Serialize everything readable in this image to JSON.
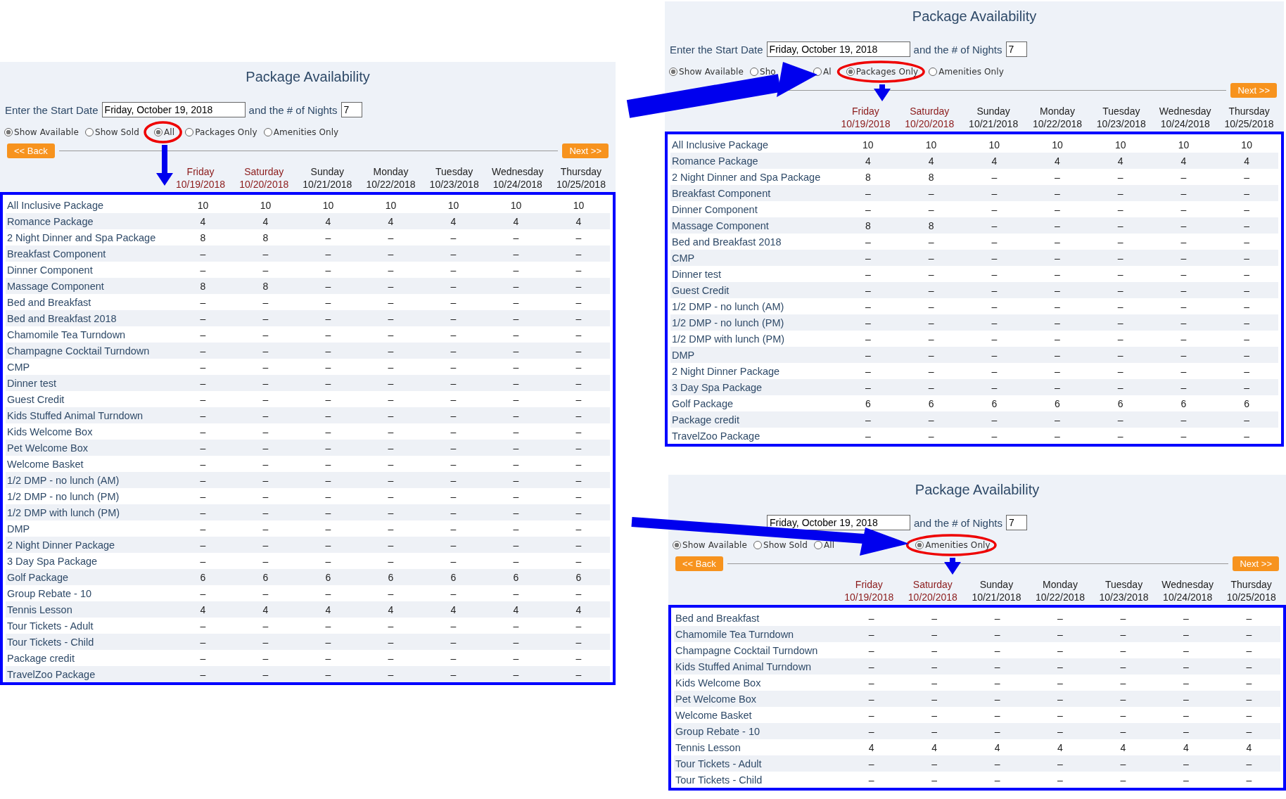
{
  "panels": [
    {
      "title": "Package Availability",
      "start_label": "Enter the Start Date",
      "date_value": "Friday, October 19, 2018",
      "nights_label": "and the # of Nights",
      "nights_value": "7",
      "show_options": [
        {
          "kind": "radio",
          "label": "Show Available",
          "selected": true
        },
        {
          "kind": "radio",
          "label": "Show Sold",
          "selected": false
        }
      ],
      "filters": [
        {
          "kind": "radio",
          "label": "All",
          "selected": true,
          "circled": true
        },
        {
          "kind": "radio",
          "label": "Packages Only",
          "selected": false,
          "circled": false
        },
        {
          "kind": "radio",
          "label": "Amenities Only",
          "selected": false,
          "circled": false
        }
      ],
      "back": "<< Back",
      "next": "Next >>",
      "days": [
        {
          "day": "Friday",
          "date": "10/19/2018",
          "weekend": true
        },
        {
          "day": "Saturday",
          "date": "10/20/2018",
          "weekend": true
        },
        {
          "day": "Sunday",
          "date": "10/21/2018",
          "weekend": false
        },
        {
          "day": "Monday",
          "date": "10/22/2018",
          "weekend": false
        },
        {
          "day": "Tuesday",
          "date": "10/23/2018",
          "weekend": false
        },
        {
          "day": "Wednesday",
          "date": "10/24/2018",
          "weekend": false
        },
        {
          "day": "Thursday",
          "date": "10/25/2018",
          "weekend": false
        }
      ],
      "rows": [
        {
          "name": "All Inclusive Package",
          "values": [
            "10",
            "10",
            "10",
            "10",
            "10",
            "10",
            "10"
          ]
        },
        {
          "name": "Romance Package",
          "values": [
            "4",
            "4",
            "4",
            "4",
            "4",
            "4",
            "4"
          ]
        },
        {
          "name": "2 Night Dinner and Spa Package",
          "values": [
            "8",
            "8",
            "–",
            "–",
            "–",
            "–",
            "–"
          ]
        },
        {
          "name": "Breakfast Component",
          "values": [
            "–",
            "–",
            "–",
            "–",
            "–",
            "–",
            "–"
          ]
        },
        {
          "name": "Dinner Component",
          "values": [
            "–",
            "–",
            "–",
            "–",
            "–",
            "–",
            "–"
          ]
        },
        {
          "name": "Massage Component",
          "values": [
            "8",
            "8",
            "–",
            "–",
            "–",
            "–",
            "–"
          ]
        },
        {
          "name": "Bed and Breakfast",
          "values": [
            "–",
            "–",
            "–",
            "–",
            "–",
            "–",
            "–"
          ]
        },
        {
          "name": "Bed and Breakfast 2018",
          "values": [
            "–",
            "–",
            "–",
            "–",
            "–",
            "–",
            "–"
          ]
        },
        {
          "name": "Chamomile Tea Turndown",
          "values": [
            "–",
            "–",
            "–",
            "–",
            "–",
            "–",
            "–"
          ]
        },
        {
          "name": "Champagne Cocktail Turndown",
          "values": [
            "–",
            "–",
            "–",
            "–",
            "–",
            "–",
            "–"
          ]
        },
        {
          "name": "CMP",
          "values": [
            "–",
            "–",
            "–",
            "–",
            "–",
            "–",
            "–"
          ]
        },
        {
          "name": "Dinner test",
          "values": [
            "–",
            "–",
            "–",
            "–",
            "–",
            "–",
            "–"
          ]
        },
        {
          "name": "Guest Credit",
          "values": [
            "–",
            "–",
            "–",
            "–",
            "–",
            "–",
            "–"
          ]
        },
        {
          "name": "Kids Stuffed Animal Turndown",
          "values": [
            "–",
            "–",
            "–",
            "–",
            "–",
            "–",
            "–"
          ]
        },
        {
          "name": "Kids Welcome Box",
          "values": [
            "–",
            "–",
            "–",
            "–",
            "–",
            "–",
            "–"
          ]
        },
        {
          "name": "Pet Welcome Box",
          "values": [
            "–",
            "–",
            "–",
            "–",
            "–",
            "–",
            "–"
          ]
        },
        {
          "name": "Welcome Basket",
          "values": [
            "–",
            "–",
            "–",
            "–",
            "–",
            "–",
            "–"
          ]
        },
        {
          "name": "1/2 DMP - no lunch (AM)",
          "values": [
            "–",
            "–",
            "–",
            "–",
            "–",
            "–",
            "–"
          ]
        },
        {
          "name": "1/2 DMP - no lunch (PM)",
          "values": [
            "–",
            "–",
            "–",
            "–",
            "–",
            "–",
            "–"
          ]
        },
        {
          "name": "1/2 DMP with lunch (PM)",
          "values": [
            "–",
            "–",
            "–",
            "–",
            "–",
            "–",
            "–"
          ]
        },
        {
          "name": "DMP",
          "values": [
            "–",
            "–",
            "–",
            "–",
            "–",
            "–",
            "–"
          ]
        },
        {
          "name": "2 Night Dinner Package",
          "values": [
            "–",
            "–",
            "–",
            "–",
            "–",
            "–",
            "–"
          ]
        },
        {
          "name": "3 Day Spa Package",
          "values": [
            "–",
            "–",
            "–",
            "–",
            "–",
            "–",
            "–"
          ]
        },
        {
          "name": "Golf Package",
          "values": [
            "6",
            "6",
            "6",
            "6",
            "6",
            "6",
            "6"
          ]
        },
        {
          "name": "Group Rebate - 10",
          "values": [
            "–",
            "–",
            "–",
            "–",
            "–",
            "–",
            "–"
          ]
        },
        {
          "name": "Tennis Lesson",
          "values": [
            "4",
            "4",
            "4",
            "4",
            "4",
            "4",
            "4"
          ]
        },
        {
          "name": "Tour Tickets - Adult",
          "values": [
            "–",
            "–",
            "–",
            "–",
            "–",
            "–",
            "–"
          ]
        },
        {
          "name": "Tour Tickets - Child",
          "values": [
            "–",
            "–",
            "–",
            "–",
            "–",
            "–",
            "–"
          ]
        },
        {
          "name": "Package credit",
          "values": [
            "–",
            "–",
            "–",
            "–",
            "–",
            "–",
            "–"
          ]
        },
        {
          "name": "TravelZoo Package",
          "values": [
            "–",
            "–",
            "–",
            "–",
            "–",
            "–",
            "–"
          ]
        }
      ]
    },
    {
      "title": "Package Availability",
      "start_label": "Enter the Start Date",
      "date_value": "Friday, October 19, 2018",
      "nights_label": "and the # of Nights",
      "nights_value": "7",
      "show_options": [
        {
          "kind": "radio",
          "label": "Show Available",
          "selected": true
        },
        {
          "kind": "cut",
          "label": "Sho",
          "selected": false
        }
      ],
      "filters": [
        {
          "kind": "radio",
          "label": "Al",
          "selected": false,
          "circled": false
        },
        {
          "kind": "radio",
          "label": "Packages Only",
          "selected": true,
          "circled": true
        },
        {
          "kind": "radio",
          "label": "Amenities Only",
          "selected": false,
          "circled": false
        }
      ],
      "next": "Next >>",
      "days": [
        {
          "day": "Friday",
          "date": "10/19/2018",
          "weekend": true
        },
        {
          "day": "Saturday",
          "date": "10/20/2018",
          "weekend": true
        },
        {
          "day": "Sunday",
          "date": "10/21/2018",
          "weekend": false
        },
        {
          "day": "Monday",
          "date": "10/22/2018",
          "weekend": false
        },
        {
          "day": "Tuesday",
          "date": "10/23/2018",
          "weekend": false
        },
        {
          "day": "Wednesday",
          "date": "10/24/2018",
          "weekend": false
        },
        {
          "day": "Thursday",
          "date": "10/25/2018",
          "weekend": false
        }
      ],
      "rows": [
        {
          "name": "All Inclusive Package",
          "values": [
            "10",
            "10",
            "10",
            "10",
            "10",
            "10",
            "10"
          ]
        },
        {
          "name": "Romance Package",
          "values": [
            "4",
            "4",
            "4",
            "4",
            "4",
            "4",
            "4"
          ]
        },
        {
          "name": "2 Night Dinner and Spa Package",
          "values": [
            "8",
            "8",
            "–",
            "–",
            "–",
            "–",
            "–"
          ]
        },
        {
          "name": "Breakfast Component",
          "values": [
            "–",
            "–",
            "–",
            "–",
            "–",
            "–",
            "–"
          ]
        },
        {
          "name": "Dinner Component",
          "values": [
            "–",
            "–",
            "–",
            "–",
            "–",
            "–",
            "–"
          ]
        },
        {
          "name": "Massage Component",
          "values": [
            "8",
            "8",
            "–",
            "–",
            "–",
            "–",
            "–"
          ]
        },
        {
          "name": "Bed and Breakfast 2018",
          "values": [
            "–",
            "–",
            "–",
            "–",
            "–",
            "–",
            "–"
          ]
        },
        {
          "name": "CMP",
          "values": [
            "–",
            "–",
            "–",
            "–",
            "–",
            "–",
            "–"
          ]
        },
        {
          "name": "Dinner test",
          "values": [
            "–",
            "–",
            "–",
            "–",
            "–",
            "–",
            "–"
          ]
        },
        {
          "name": "Guest Credit",
          "values": [
            "–",
            "–",
            "–",
            "–",
            "–",
            "–",
            "–"
          ]
        },
        {
          "name": "1/2 DMP - no lunch (AM)",
          "values": [
            "–",
            "–",
            "–",
            "–",
            "–",
            "–",
            "–"
          ]
        },
        {
          "name": "1/2 DMP - no lunch (PM)",
          "values": [
            "–",
            "–",
            "–",
            "–",
            "–",
            "–",
            "–"
          ]
        },
        {
          "name": "1/2 DMP with lunch (PM)",
          "values": [
            "–",
            "–",
            "–",
            "–",
            "–",
            "–",
            "–"
          ]
        },
        {
          "name": "DMP",
          "values": [
            "–",
            "–",
            "–",
            "–",
            "–",
            "–",
            "–"
          ]
        },
        {
          "name": "2 Night Dinner Package",
          "values": [
            "–",
            "–",
            "–",
            "–",
            "–",
            "–",
            "–"
          ]
        },
        {
          "name": "3 Day Spa Package",
          "values": [
            "–",
            "–",
            "–",
            "–",
            "–",
            "–",
            "–"
          ]
        },
        {
          "name": "Golf Package",
          "values": [
            "6",
            "6",
            "6",
            "6",
            "6",
            "6",
            "6"
          ]
        },
        {
          "name": "Package credit",
          "values": [
            "–",
            "–",
            "–",
            "–",
            "–",
            "–",
            "–"
          ]
        },
        {
          "name": "TravelZoo Package",
          "values": [
            "–",
            "–",
            "–",
            "–",
            "–",
            "–",
            "–"
          ]
        }
      ]
    },
    {
      "title": "Package Availability",
      "date_value": "Friday, October 19, 2018",
      "nights_label": "and the # of Nights",
      "nights_value": "7",
      "show_options": [
        {
          "kind": "radio",
          "label": "Show Available",
          "selected": true
        },
        {
          "kind": "radio",
          "label": "Show Sold",
          "selected": false
        }
      ],
      "filters": [
        {
          "kind": "radio",
          "label": "All",
          "selected": false,
          "circled": false
        },
        {
          "kind": "covered"
        },
        {
          "kind": "radio",
          "label": "Amenities Only",
          "selected": true,
          "circled": true
        }
      ],
      "back": "<< Back",
      "next": "Next >>",
      "days": [
        {
          "day": "Friday",
          "date": "10/19/2018",
          "weekend": true
        },
        {
          "day": "Saturday",
          "date": "10/20/2018",
          "weekend": true
        },
        {
          "day": "Sunday",
          "date": "10/21/2018",
          "weekend": false
        },
        {
          "day": "Monday",
          "date": "10/22/2018",
          "weekend": false
        },
        {
          "day": "Tuesday",
          "date": "10/23/2018",
          "weekend": false
        },
        {
          "day": "Wednesday",
          "date": "10/24/2018",
          "weekend": false
        },
        {
          "day": "Thursday",
          "date": "10/25/2018",
          "weekend": false
        }
      ],
      "rows": [
        {
          "name": "Bed and Breakfast",
          "values": [
            "–",
            "–",
            "–",
            "–",
            "–",
            "–",
            "–"
          ]
        },
        {
          "name": "Chamomile Tea Turndown",
          "values": [
            "–",
            "–",
            "–",
            "–",
            "–",
            "–",
            "–"
          ]
        },
        {
          "name": "Champagne Cocktail Turndown",
          "values": [
            "–",
            "–",
            "–",
            "–",
            "–",
            "–",
            "–"
          ]
        },
        {
          "name": "Kids Stuffed Animal Turndown",
          "values": [
            "–",
            "–",
            "–",
            "–",
            "–",
            "–",
            "–"
          ]
        },
        {
          "name": "Kids Welcome Box",
          "values": [
            "–",
            "–",
            "–",
            "–",
            "–",
            "–",
            "–"
          ]
        },
        {
          "name": "Pet Welcome Box",
          "values": [
            "–",
            "–",
            "–",
            "–",
            "–",
            "–",
            "–"
          ]
        },
        {
          "name": "Welcome Basket",
          "values": [
            "–",
            "–",
            "–",
            "–",
            "–",
            "–",
            "–"
          ]
        },
        {
          "name": "Group Rebate - 10",
          "values": [
            "–",
            "–",
            "–",
            "–",
            "–",
            "–",
            "–"
          ]
        },
        {
          "name": "Tennis Lesson",
          "values": [
            "4",
            "4",
            "4",
            "4",
            "4",
            "4",
            "4"
          ]
        },
        {
          "name": "Tour Tickets - Adult",
          "values": [
            "–",
            "–",
            "–",
            "–",
            "–",
            "–",
            "–"
          ]
        },
        {
          "name": "Tour Tickets - Child",
          "values": [
            "–",
            "–",
            "–",
            "–",
            "–",
            "–",
            "–"
          ]
        }
      ]
    }
  ]
}
